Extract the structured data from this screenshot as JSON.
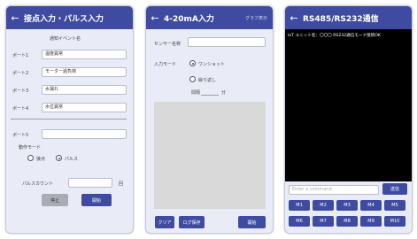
{
  "screen1": {
    "title": "接点入力・パルス入力",
    "section_label": "通知イベント名",
    "ports": [
      {
        "label": "ポート1",
        "value": "温度異常"
      },
      {
        "label": "ポート2",
        "value": "モーター過負荷"
      },
      {
        "label": "ポート3",
        "value": "水漏れ"
      },
      {
        "label": "ポート4",
        "value": "水位異常"
      },
      {
        "label": "ポート5",
        "value": ""
      }
    ],
    "mode_label": "動作モード",
    "mode_options": [
      {
        "label": "接点",
        "selected": false
      },
      {
        "label": "パルス",
        "selected": true
      }
    ],
    "pulse_label": "パルスカウント",
    "pulse_value": "",
    "pulse_unit": "回",
    "stop_label": "停止",
    "start_label": "開始"
  },
  "screen2": {
    "title": "4-20mA入力",
    "graph_link": "グラフ表示",
    "sensor_label": "センサー名称",
    "sensor_value": "",
    "input_mode_label": "入力モード",
    "mode_options": [
      {
        "label": "ワンショット",
        "selected": true
      },
      {
        "label": "繰り返し",
        "selected": false
      }
    ],
    "period_label": "間隔",
    "period_value": "",
    "period_unit": "分",
    "clear_label": "クリア",
    "save_log_label": "ログ保存",
    "start_label": "開始"
  },
  "screen3": {
    "title": "RS485/RS232通信",
    "terminal_text": "IoT ユニット名：〇〇〇 RS232通信モード接続OK",
    "command_placeholder": "Enter a command",
    "send_label": "送信",
    "macro_buttons": [
      "M1",
      "M2",
      "M3",
      "M4",
      "M5",
      "M6",
      "M7",
      "M8",
      "M9",
      "M10"
    ]
  },
  "colors": {
    "accent": "#3f4ba1",
    "screen_bg": "#e9ecf7",
    "terminal_bg": "#000000",
    "graph_bg": "#d9d9d9"
  },
  "icons": {
    "back": "arrow-left-icon"
  }
}
